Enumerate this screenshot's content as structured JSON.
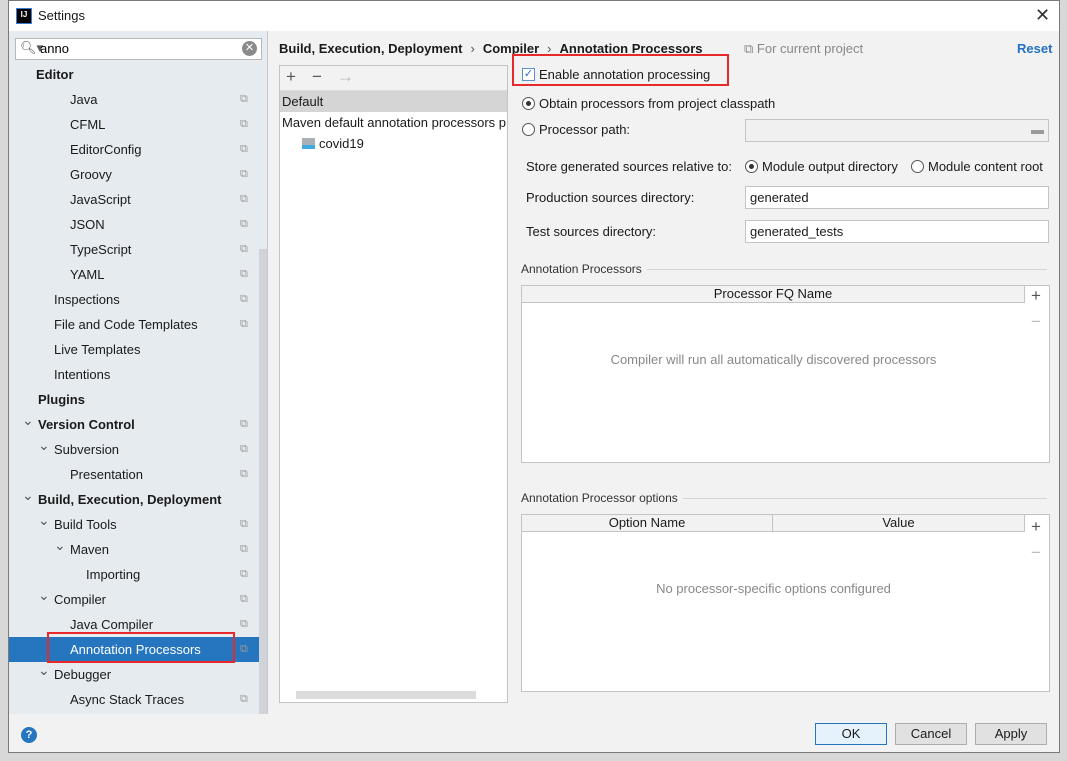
{
  "window": {
    "title": "Settings"
  },
  "search": {
    "value": "anno"
  },
  "tree": [
    {
      "label": "Editor",
      "level": 0,
      "bold": true,
      "copy": false
    },
    {
      "label": "Java",
      "level": 2,
      "copy": true
    },
    {
      "label": "CFML",
      "level": 2,
      "copy": true
    },
    {
      "label": "EditorConfig",
      "level": 2,
      "copy": true
    },
    {
      "label": "Groovy",
      "level": 2,
      "copy": true
    },
    {
      "label": "JavaScript",
      "level": 2,
      "copy": true
    },
    {
      "label": "JSON",
      "level": 2,
      "copy": true
    },
    {
      "label": "TypeScript",
      "level": 2,
      "copy": true
    },
    {
      "label": "YAML",
      "level": 2,
      "copy": true
    },
    {
      "label": "Inspections",
      "level": 1,
      "copy": true
    },
    {
      "label": "File and Code Templates",
      "level": 1,
      "copy": true
    },
    {
      "label": "Live Templates",
      "level": 1,
      "copy": false
    },
    {
      "label": "Intentions",
      "level": 1,
      "copy": false
    },
    {
      "label": "Plugins",
      "level": 0,
      "bold": true,
      "copy": false
    },
    {
      "label": "Version Control",
      "level": 0,
      "bold": true,
      "arrow": true,
      "copy": true
    },
    {
      "label": "Subversion",
      "level": 1,
      "arrow": true,
      "copy": true
    },
    {
      "label": "Presentation",
      "level": 2,
      "copy": true
    },
    {
      "label": "Build, Execution, Deployment",
      "level": 0,
      "bold": true,
      "arrow": true,
      "copy": false
    },
    {
      "label": "Build Tools",
      "level": 1,
      "arrow": true,
      "copy": true
    },
    {
      "label": "Maven",
      "level": 2,
      "arrow": true,
      "copy": true
    },
    {
      "label": "Importing",
      "level": 3,
      "copy": true
    },
    {
      "label": "Compiler",
      "level": 1,
      "arrow": true,
      "copy": true
    },
    {
      "label": "Java Compiler",
      "level": 2,
      "copy": true
    },
    {
      "label": "Annotation Processors",
      "level": 2,
      "copy": true,
      "selected": true
    },
    {
      "label": "Debugger",
      "level": 1,
      "arrow": true,
      "copy": false
    },
    {
      "label": "Async Stack Traces",
      "level": 2,
      "copy": true
    }
  ],
  "breadcrumb": [
    "Build, Execution, Deployment",
    "Compiler",
    "Annotation Processors"
  ],
  "for_current_project": "For current project",
  "reset": "Reset",
  "profiles": {
    "items": [
      "Default",
      "Maven default annotation processors p"
    ],
    "module": "covid19"
  },
  "form": {
    "enable": "Enable annotation processing",
    "enable_checked": true,
    "obtain": "Obtain processors from project classpath",
    "processor_path": "Processor path:",
    "store_label": "Store generated sources relative to:",
    "module_output": "Module output directory",
    "module_content": "Module content root",
    "prod_label": "Production sources directory:",
    "prod_value": "generated",
    "test_label": "Test sources directory:",
    "test_value": "generated_tests"
  },
  "processors": {
    "title": "Annotation Processors",
    "column": "Processor FQ Name",
    "empty": "Compiler will run all automatically discovered processors"
  },
  "options": {
    "title": "Annotation Processor options",
    "columns": [
      "Option Name",
      "Value"
    ],
    "empty": "No processor-specific options configured"
  },
  "buttons": {
    "ok": "OK",
    "cancel": "Cancel",
    "apply": "Apply",
    "help": "?"
  },
  "colors": {
    "accent": "#2675bf",
    "highlight": "#e8282b"
  }
}
